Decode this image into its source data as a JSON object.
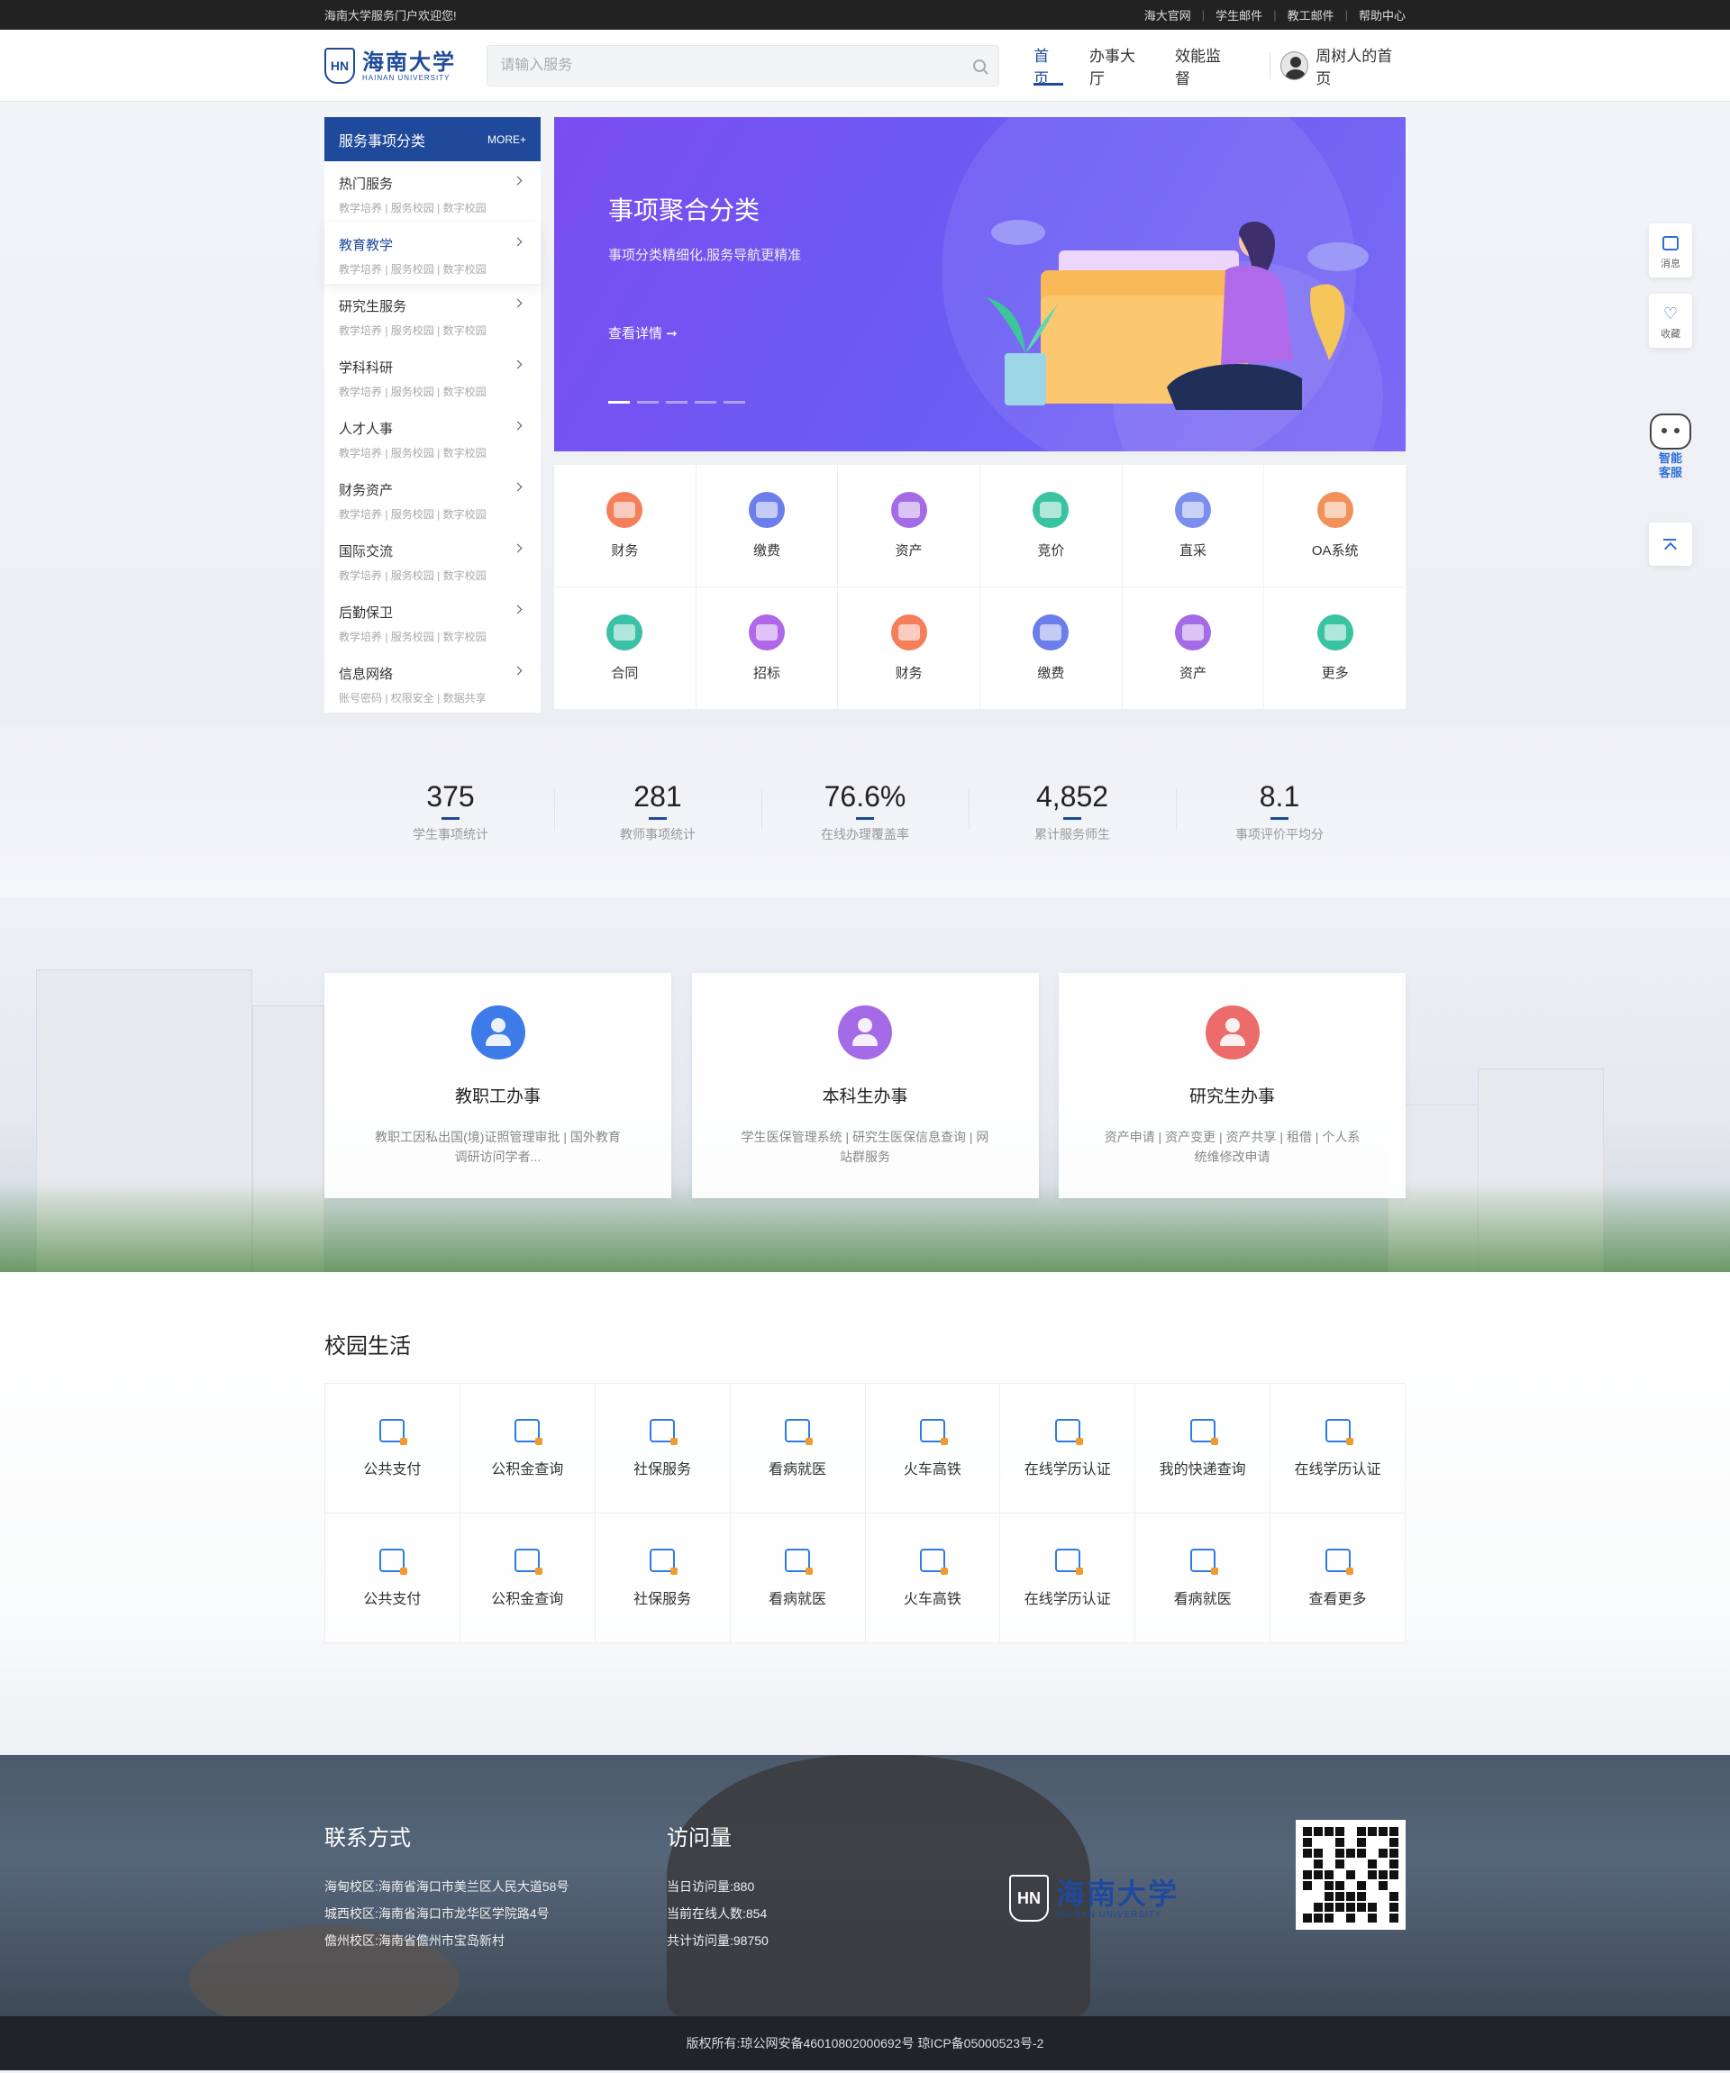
{
  "topbar": {
    "welcome": "海南大学服务门户欢迎您!",
    "links": [
      "海大官网",
      "学生邮件",
      "教工邮件",
      "帮助中心"
    ]
  },
  "header": {
    "logo_badge": "HN",
    "logo_cn": "海南大学",
    "logo_en": "HAINAN UNIVERSITY",
    "search_placeholder": "请输入服务",
    "nav": [
      "首页",
      "办事大厅",
      "效能监督"
    ],
    "user_label": "周树人的首页"
  },
  "sidebar": {
    "title": "服务事项分类",
    "more": "MORE+",
    "items": [
      {
        "title": "热门服务",
        "sub": "教学培养 | 服务校园 | 数字校园"
      },
      {
        "title": "教育教学",
        "sub": "教学培养 | 服务校园 | 数字校园"
      },
      {
        "title": "研究生服务",
        "sub": "教学培养 | 服务校园 | 数字校园"
      },
      {
        "title": "学科科研",
        "sub": "教学培养 | 服务校园 | 数字校园"
      },
      {
        "title": "人才人事",
        "sub": "教学培养 | 服务校园 | 数字校园"
      },
      {
        "title": "财务资产",
        "sub": "教学培养 | 服务校园 | 数字校园"
      },
      {
        "title": "国际交流",
        "sub": "教学培养 | 服务校园 | 数字校园"
      },
      {
        "title": "后勤保卫",
        "sub": "教学培养 | 服务校园 | 数字校园"
      },
      {
        "title": "信息网络",
        "sub": "账号密码 | 权限安全 | 数据共享"
      }
    ]
  },
  "banner": {
    "title": "事项聚合分类",
    "subtitle": "事项分类精细化,服务导航更精准",
    "link": "查看详情 ➞"
  },
  "quick": [
    {
      "label": "财务",
      "color": "#f47f5a"
    },
    {
      "label": "缴费",
      "color": "#6b7ee9"
    },
    {
      "label": "资产",
      "color": "#a46be6"
    },
    {
      "label": "竞价",
      "color": "#39c3a0"
    },
    {
      "label": "直采",
      "color": "#7c8df0"
    },
    {
      "label": "OA系统",
      "color": "#f2925a"
    },
    {
      "label": "合同",
      "color": "#3bc1a5"
    },
    {
      "label": "招标",
      "color": "#b068e8"
    },
    {
      "label": "财务",
      "color": "#f47f5a"
    },
    {
      "label": "缴费",
      "color": "#6b7ee9"
    },
    {
      "label": "资产",
      "color": "#a46be6"
    },
    {
      "label": "更多",
      "color": "#39c3a0"
    }
  ],
  "stats": [
    {
      "value": "375",
      "label": "学生事项统计"
    },
    {
      "value": "281",
      "label": "教师事项统计"
    },
    {
      "value": "76.6%",
      "label": "在线办理覆盖率"
    },
    {
      "value": "4,852",
      "label": "累计服务师生"
    },
    {
      "value": "8.1",
      "label": "事项评价平均分"
    }
  ],
  "roles": [
    {
      "title": "教职工办事",
      "desc": "教职工因私出国(境)证照管理审批 | 国外教育调研访问学者...",
      "color": "#3d7be8"
    },
    {
      "title": "本科生办事",
      "desc": "学生医保管理系统 | 研究生医保信息查询 | 网站群服务",
      "color": "#a56ae6"
    },
    {
      "title": "研究生办事",
      "desc": "资产申请 | 资产变更 | 资产共享 | 租借 | 个人系统维修改申请",
      "color": "#ec6b6b"
    }
  ],
  "life": {
    "title": "校园生活",
    "items": [
      "公共支付",
      "公积金查询",
      "社保服务",
      "看病就医",
      "火车高铁",
      "在线学历认证",
      "我的快递查询",
      "在线学历认证",
      "公共支付",
      "公积金查询",
      "社保服务",
      "看病就医",
      "火车高铁",
      "在线学历认证",
      "看病就医",
      "查看更多"
    ]
  },
  "footer": {
    "contact_title": "联系方式",
    "contacts": [
      "海甸校区:海南省海口市美兰区人民大道58号",
      "城西校区:海南省海口市龙华区学院路4号",
      "儋州校区:海南省儋州市宝岛新村"
    ],
    "visits_title": "访问量",
    "visits": [
      "当日访问量:880",
      "当前在线人数:854",
      "共计访问量:98750"
    ],
    "copyright": "版权所有:琼公网安备46010802000692号 琼ICP备05000523号-2"
  },
  "floating": {
    "message": "消息",
    "favorite": "收藏",
    "robot": "智能客服"
  }
}
